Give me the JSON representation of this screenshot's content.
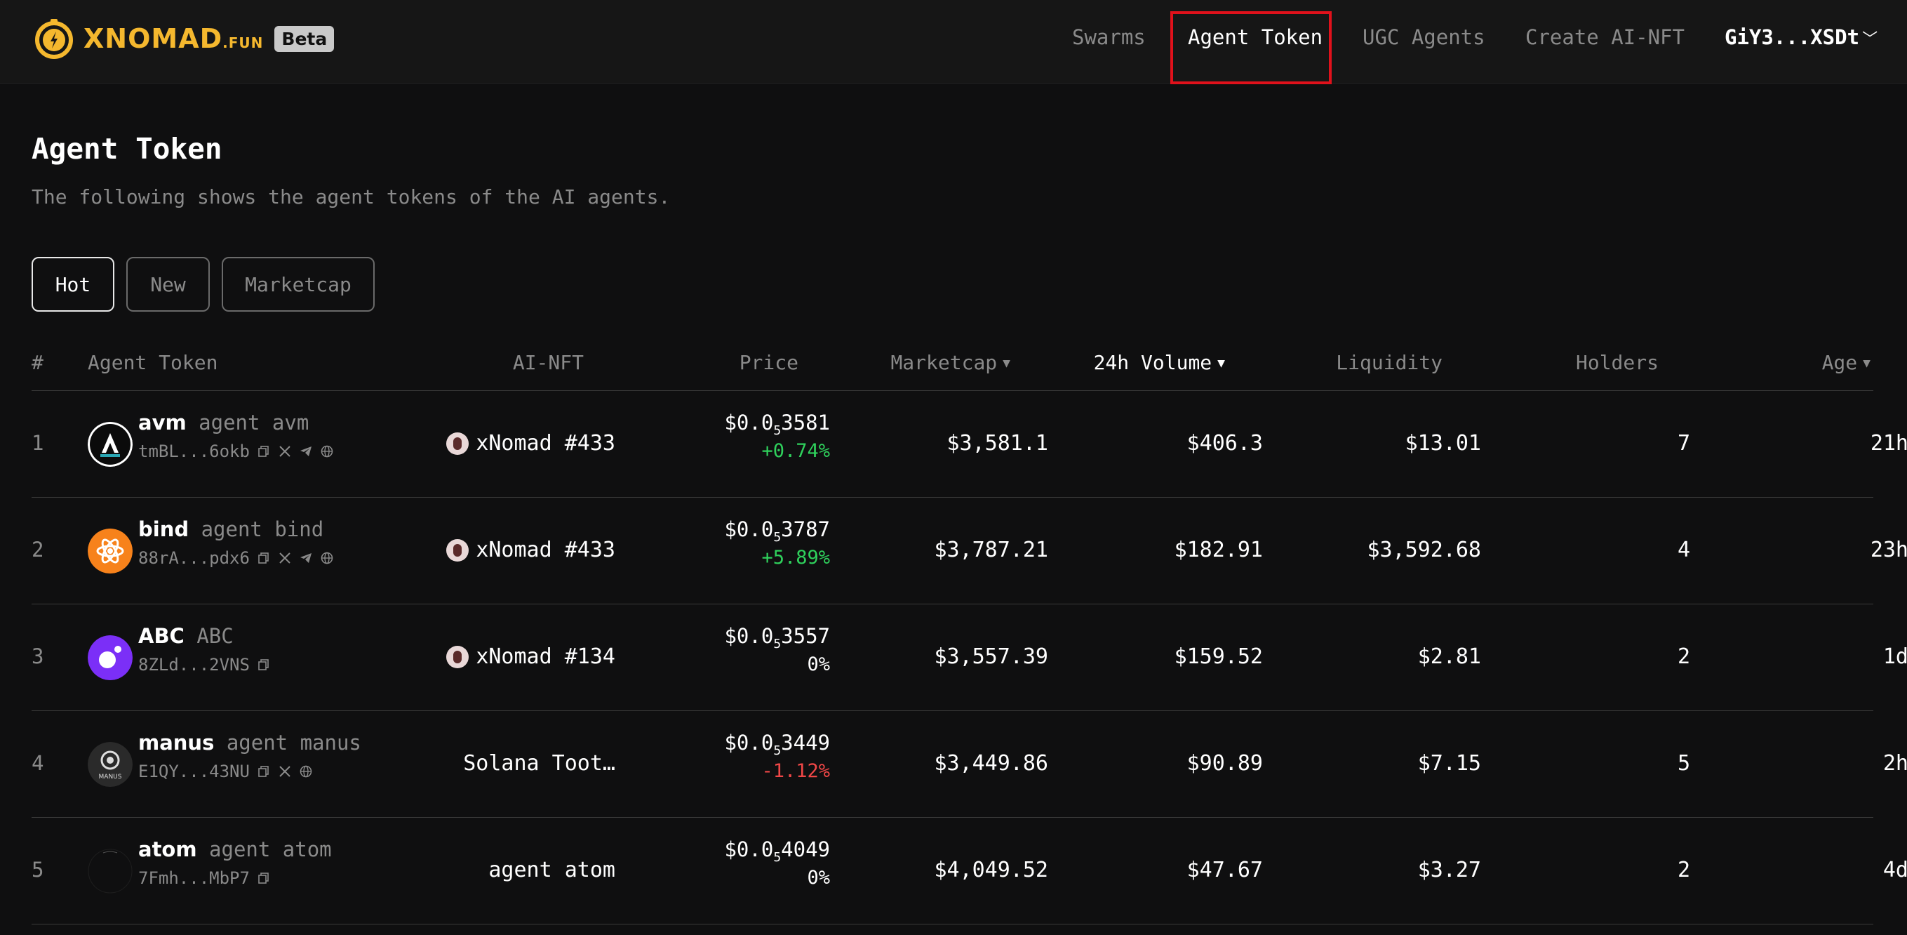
{
  "header": {
    "logo_text": "XNOMAD",
    "logo_suffix": ".FUN",
    "beta_label": "Beta",
    "nav": [
      "Swarms",
      "Agent Token",
      "UGC Agents",
      "Create AI-NFT"
    ],
    "active_nav": "Agent Token",
    "wallet": "GiY3...XSDt"
  },
  "page": {
    "title": "Agent Token",
    "subtitle": "The following shows the agent tokens of the AI agents."
  },
  "tabs": [
    "Hot",
    "New",
    "Marketcap"
  ],
  "active_tab": "Hot",
  "columns": {
    "rank": "#",
    "token": "Agent Token",
    "nft": "AI-NFT",
    "price": "Price",
    "marketcap": "Marketcap",
    "volume": "24h Volume",
    "liquidity": "Liquidity",
    "holders": "Holders",
    "age": "Age"
  },
  "rows": [
    {
      "rank": "1",
      "symbol": "avm",
      "name": "agent avm",
      "address": "tmBL...6okb",
      "nft": "xNomad #433",
      "price_prefix": "$0.0",
      "price_zeros": "5",
      "price_digits": "3581",
      "change": "+0.74%",
      "change_dir": "up",
      "marketcap": "$3,581.1",
      "volume": "$406.3",
      "liquidity": "$13.01",
      "holders": "7",
      "age": "21h"
    },
    {
      "rank": "2",
      "symbol": "bind",
      "name": "agent bind",
      "address": "88rA...pdx6",
      "nft": "xNomad #433",
      "price_prefix": "$0.0",
      "price_zeros": "5",
      "price_digits": "3787",
      "change": "+5.89%",
      "change_dir": "up",
      "marketcap": "$3,787.21",
      "volume": "$182.91",
      "liquidity": "$3,592.68",
      "holders": "4",
      "age": "23h"
    },
    {
      "rank": "3",
      "symbol": "ABC",
      "name": "ABC",
      "address": "8ZLd...2VNS",
      "nft": "xNomad #134",
      "price_prefix": "$0.0",
      "price_zeros": "5",
      "price_digits": "3557",
      "change": "0%",
      "change_dir": "flat",
      "marketcap": "$3,557.39",
      "volume": "$159.52",
      "liquidity": "$2.81",
      "holders": "2",
      "age": "1d"
    },
    {
      "rank": "4",
      "symbol": "manus",
      "name": "agent manus",
      "address": "E1QY...43NU",
      "nft": "Solana Toot…",
      "price_prefix": "$0.0",
      "price_zeros": "5",
      "price_digits": "3449",
      "change": "-1.12%",
      "change_dir": "down",
      "marketcap": "$3,449.86",
      "volume": "$90.89",
      "liquidity": "$7.15",
      "holders": "5",
      "age": "2h"
    },
    {
      "rank": "5",
      "symbol": "atom",
      "name": "agent atom",
      "address": "7Fmh...MbP7",
      "nft": "agent atom",
      "price_prefix": "$0.0",
      "price_zeros": "5",
      "price_digits": "4049",
      "change": "0%",
      "change_dir": "flat",
      "marketcap": "$4,049.52",
      "volume": "$47.67",
      "liquidity": "$3.27",
      "holders": "2",
      "age": "4d"
    }
  ],
  "colors": {
    "brand": "#f5b82e",
    "up": "#2fd15c",
    "down": "#f04747",
    "highlight_box": "#e0111b",
    "background": "#0f0f10"
  }
}
